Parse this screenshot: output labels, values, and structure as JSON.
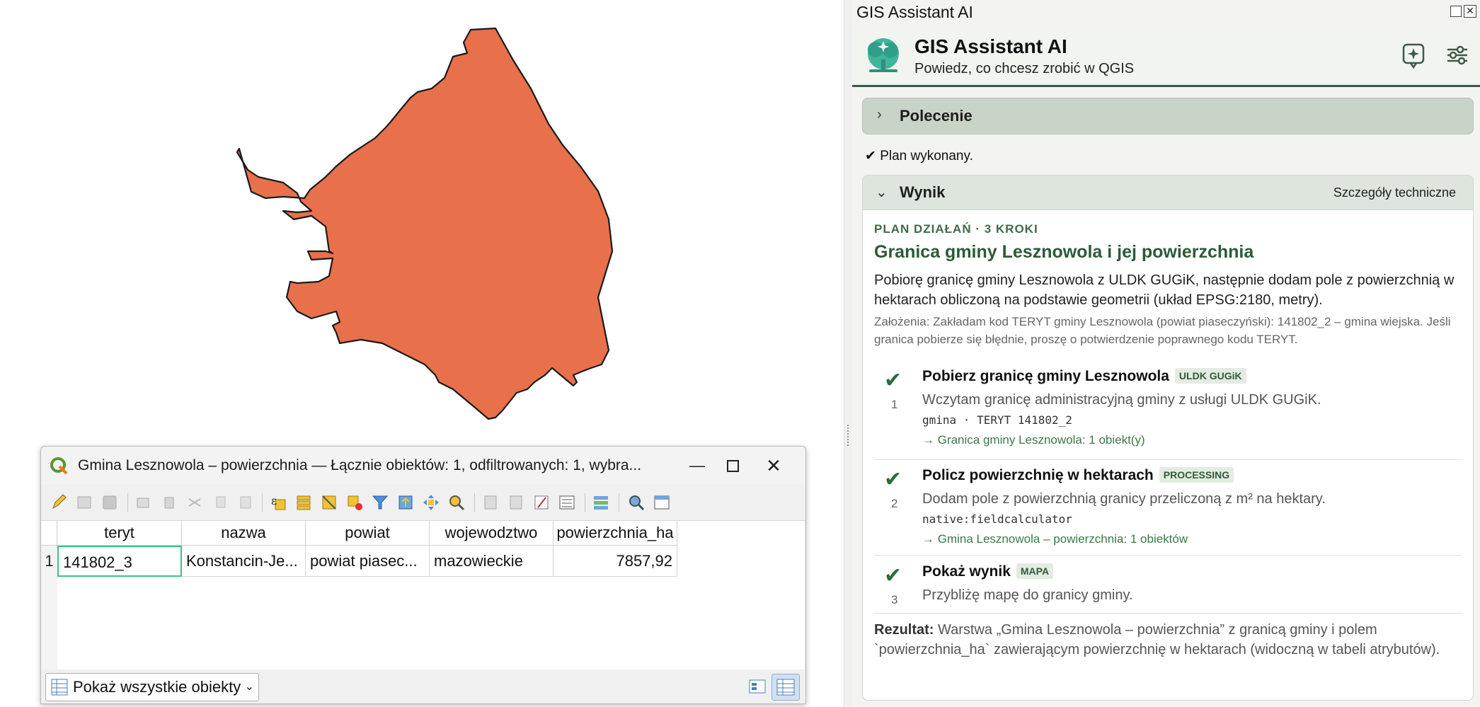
{
  "map": {
    "polygon_fill": "#e8704a",
    "polygon_stroke": "#1a1a1a"
  },
  "attribute_table": {
    "title": "Gmina Lesznowola – powierzchnia — Łącznie obiektów: 1, odfiltrowanych: 1, wybra...",
    "columns": [
      "teryt",
      "nazwa",
      "powiat",
      "wojewodztwo",
      "powierzchnia_ha"
    ],
    "rows": [
      {
        "num": "1",
        "teryt": "141802_3",
        "nazwa": "Konstancin-Je...",
        "powiat": "powiat piasec...",
        "wojewodztwo": "mazowieckie",
        "powierzchnia_ha": "7857,92"
      }
    ],
    "show_all_label": "Pokaż wszystkie obiekty"
  },
  "panel": {
    "dock_title": "GIS Assistant AI",
    "header_title": "GIS Assistant AI",
    "header_subtitle": "Powiedz, co chcesz zrobić w QGIS",
    "accent_color": "#3e5a46",
    "command_section": "Polecenie",
    "plan_status": "✔ Plan wykonany.",
    "result_section": "Wynik",
    "tech_details": "Szczegóły techniczne",
    "plan_label": "PLAN DZIAŁAŃ · 3 KROKI",
    "plan_title": "Granica gminy Lesznowola i jej powierzchnia",
    "plan_description": "Pobiorę granicę gminy Lesznowola z ULDK GUGiK, następnie dodam pole z powierzchnią w hektarach obliczoną na podstawie geometrii (układ EPSG:2180, metry).",
    "plan_assumptions": "Założenia: Zakładam kod TERYT gminy Lesznowola (powiat piaseczyński): 141802_2 – gmina wiejska. Jeśli granica pobierze się błędnie, proszę o potwierdzenie poprawnego kodu TERYT.",
    "steps": [
      {
        "num": "1",
        "check": "✔",
        "title": "Pobierz granicę gminy Lesznowola",
        "tag": "ULDK GUGiK",
        "description": "Wczytam granicę administracyjną gminy z usługi ULDK GUGiK.",
        "code": "gmina · TERYT 141802_2",
        "output": "→ Granica gminy Lesznowola: 1 obiekt(y)"
      },
      {
        "num": "2",
        "check": "✔",
        "title": "Policz powierzchnię w hektarach",
        "tag": "PROCESSING",
        "description": "Dodam pole z powierzchnią granicy przeliczoną z m² na hektary.",
        "code": "native:fieldcalculator",
        "output": "→ Gmina Lesznowola – powierzchnia: 1 obiektów"
      },
      {
        "num": "3",
        "check": "✔",
        "title": "Pokaż wynik",
        "tag": "MAPA",
        "description": "Przybliżę mapę do granicy gminy.",
        "code": "",
        "output": ""
      }
    ],
    "result_label": "Rezultat:",
    "result_text": "Warstwa „Gmina Lesznowola – powierzchnia” z granicą gminy i polem `powierzchnia_ha` zawierającym powierzchnię w hektarach (widoczną w tabeli atrybutów)."
  }
}
